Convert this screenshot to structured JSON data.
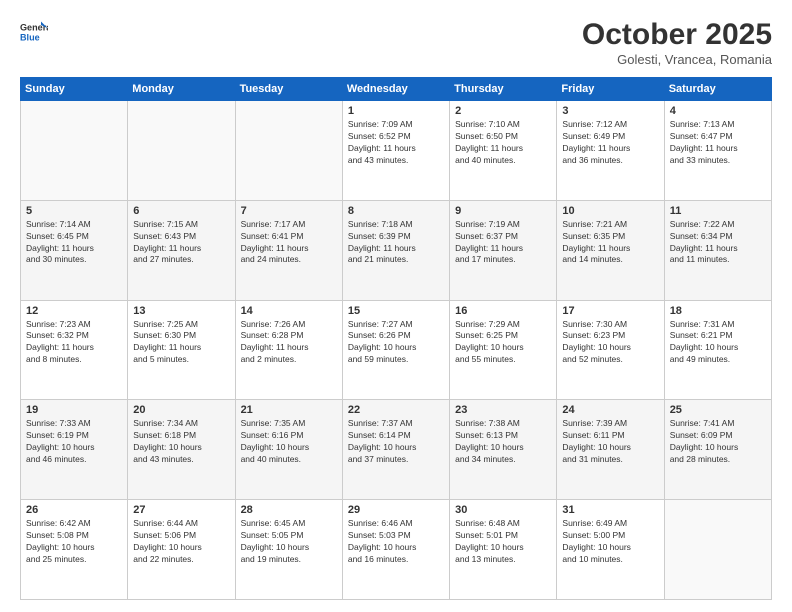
{
  "logo": {
    "general": "General",
    "blue": "Blue"
  },
  "title": "October 2025",
  "subtitle": "Golesti, Vrancea, Romania",
  "weekdays": [
    "Sunday",
    "Monday",
    "Tuesday",
    "Wednesday",
    "Thursday",
    "Friday",
    "Saturday"
  ],
  "weeks": [
    [
      {
        "day": "",
        "info": ""
      },
      {
        "day": "",
        "info": ""
      },
      {
        "day": "",
        "info": ""
      },
      {
        "day": "1",
        "info": "Sunrise: 7:09 AM\nSunset: 6:52 PM\nDaylight: 11 hours\nand 43 minutes."
      },
      {
        "day": "2",
        "info": "Sunrise: 7:10 AM\nSunset: 6:50 PM\nDaylight: 11 hours\nand 40 minutes."
      },
      {
        "day": "3",
        "info": "Sunrise: 7:12 AM\nSunset: 6:49 PM\nDaylight: 11 hours\nand 36 minutes."
      },
      {
        "day": "4",
        "info": "Sunrise: 7:13 AM\nSunset: 6:47 PM\nDaylight: 11 hours\nand 33 minutes."
      }
    ],
    [
      {
        "day": "5",
        "info": "Sunrise: 7:14 AM\nSunset: 6:45 PM\nDaylight: 11 hours\nand 30 minutes."
      },
      {
        "day": "6",
        "info": "Sunrise: 7:15 AM\nSunset: 6:43 PM\nDaylight: 11 hours\nand 27 minutes."
      },
      {
        "day": "7",
        "info": "Sunrise: 7:17 AM\nSunset: 6:41 PM\nDaylight: 11 hours\nand 24 minutes."
      },
      {
        "day": "8",
        "info": "Sunrise: 7:18 AM\nSunset: 6:39 PM\nDaylight: 11 hours\nand 21 minutes."
      },
      {
        "day": "9",
        "info": "Sunrise: 7:19 AM\nSunset: 6:37 PM\nDaylight: 11 hours\nand 17 minutes."
      },
      {
        "day": "10",
        "info": "Sunrise: 7:21 AM\nSunset: 6:35 PM\nDaylight: 11 hours\nand 14 minutes."
      },
      {
        "day": "11",
        "info": "Sunrise: 7:22 AM\nSunset: 6:34 PM\nDaylight: 11 hours\nand 11 minutes."
      }
    ],
    [
      {
        "day": "12",
        "info": "Sunrise: 7:23 AM\nSunset: 6:32 PM\nDaylight: 11 hours\nand 8 minutes."
      },
      {
        "day": "13",
        "info": "Sunrise: 7:25 AM\nSunset: 6:30 PM\nDaylight: 11 hours\nand 5 minutes."
      },
      {
        "day": "14",
        "info": "Sunrise: 7:26 AM\nSunset: 6:28 PM\nDaylight: 11 hours\nand 2 minutes."
      },
      {
        "day": "15",
        "info": "Sunrise: 7:27 AM\nSunset: 6:26 PM\nDaylight: 10 hours\nand 59 minutes."
      },
      {
        "day": "16",
        "info": "Sunrise: 7:29 AM\nSunset: 6:25 PM\nDaylight: 10 hours\nand 55 minutes."
      },
      {
        "day": "17",
        "info": "Sunrise: 7:30 AM\nSunset: 6:23 PM\nDaylight: 10 hours\nand 52 minutes."
      },
      {
        "day": "18",
        "info": "Sunrise: 7:31 AM\nSunset: 6:21 PM\nDaylight: 10 hours\nand 49 minutes."
      }
    ],
    [
      {
        "day": "19",
        "info": "Sunrise: 7:33 AM\nSunset: 6:19 PM\nDaylight: 10 hours\nand 46 minutes."
      },
      {
        "day": "20",
        "info": "Sunrise: 7:34 AM\nSunset: 6:18 PM\nDaylight: 10 hours\nand 43 minutes."
      },
      {
        "day": "21",
        "info": "Sunrise: 7:35 AM\nSunset: 6:16 PM\nDaylight: 10 hours\nand 40 minutes."
      },
      {
        "day": "22",
        "info": "Sunrise: 7:37 AM\nSunset: 6:14 PM\nDaylight: 10 hours\nand 37 minutes."
      },
      {
        "day": "23",
        "info": "Sunrise: 7:38 AM\nSunset: 6:13 PM\nDaylight: 10 hours\nand 34 minutes."
      },
      {
        "day": "24",
        "info": "Sunrise: 7:39 AM\nSunset: 6:11 PM\nDaylight: 10 hours\nand 31 minutes."
      },
      {
        "day": "25",
        "info": "Sunrise: 7:41 AM\nSunset: 6:09 PM\nDaylight: 10 hours\nand 28 minutes."
      }
    ],
    [
      {
        "day": "26",
        "info": "Sunrise: 6:42 AM\nSunset: 5:08 PM\nDaylight: 10 hours\nand 25 minutes."
      },
      {
        "day": "27",
        "info": "Sunrise: 6:44 AM\nSunset: 5:06 PM\nDaylight: 10 hours\nand 22 minutes."
      },
      {
        "day": "28",
        "info": "Sunrise: 6:45 AM\nSunset: 5:05 PM\nDaylight: 10 hours\nand 19 minutes."
      },
      {
        "day": "29",
        "info": "Sunrise: 6:46 AM\nSunset: 5:03 PM\nDaylight: 10 hours\nand 16 minutes."
      },
      {
        "day": "30",
        "info": "Sunrise: 6:48 AM\nSunset: 5:01 PM\nDaylight: 10 hours\nand 13 minutes."
      },
      {
        "day": "31",
        "info": "Sunrise: 6:49 AM\nSunset: 5:00 PM\nDaylight: 10 hours\nand 10 minutes."
      },
      {
        "day": "",
        "info": ""
      }
    ]
  ]
}
